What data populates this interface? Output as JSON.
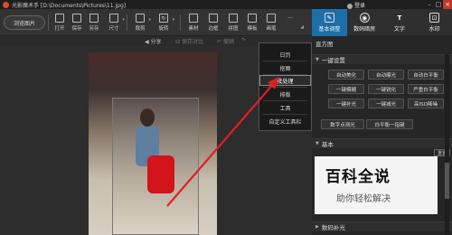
{
  "titlebar": {
    "title": "光影魔术手 [D:\\Documents\\Pictures\\11.jpg]",
    "user": "登录",
    "minimize": "–",
    "maximize": "□",
    "close": "×"
  },
  "toolbar": {
    "browse_label": "浏览图片",
    "tools": [
      {
        "label": "打开",
        "icon": "folder-icon"
      },
      {
        "label": "保存",
        "icon": "save-icon"
      },
      {
        "label": "另存",
        "icon": "save-as-icon"
      },
      {
        "label": "尺寸",
        "icon": "resize-icon"
      },
      {
        "label": "裁剪",
        "icon": "crop-icon"
      },
      {
        "label": "旋转",
        "icon": "rotate-icon"
      },
      {
        "label": "素材",
        "icon": "sticker-icon"
      },
      {
        "label": "边框",
        "icon": "border-icon"
      },
      {
        "label": "拼图",
        "icon": "collage-icon"
      },
      {
        "label": "模板",
        "icon": "template-icon"
      },
      {
        "label": "画笔",
        "icon": "brush-icon"
      },
      {
        "label": "···",
        "icon": "more-icon"
      }
    ]
  },
  "modetabs": [
    {
      "label": "基本调整",
      "active": true
    },
    {
      "label": "数码暗房",
      "active": false
    },
    {
      "label": "文字",
      "active": false
    },
    {
      "label": "水印",
      "active": false
    }
  ],
  "subbar": {
    "share": "分享",
    "save_compare": "保存对比",
    "undo": "撤销",
    "redo": "重做"
  },
  "dropdown": {
    "items": [
      "日历",
      "抠图",
      "批处理",
      "排版",
      "工具",
      "自定义工具栏"
    ],
    "highlighted_index": 2
  },
  "rightpanel": {
    "histogram": "直方图",
    "one_click_settings": "一键设置",
    "buttons": [
      "自动美化",
      "自动曝光",
      "自动白平衡",
      "一键模糊",
      "一键锐化",
      "严重白平衡",
      "一键补光",
      "一键减光",
      "高ISO降噪",
      "数字点测光",
      "白平衡一指键"
    ],
    "basic": "基本",
    "reset": "重置",
    "digital_fill": "数码补光"
  },
  "watermark": {
    "title": "百科全说",
    "subtitle": "助你轻松解决"
  },
  "colors": {
    "accent": "#1d6fa8",
    "arrow": "#e02020"
  }
}
